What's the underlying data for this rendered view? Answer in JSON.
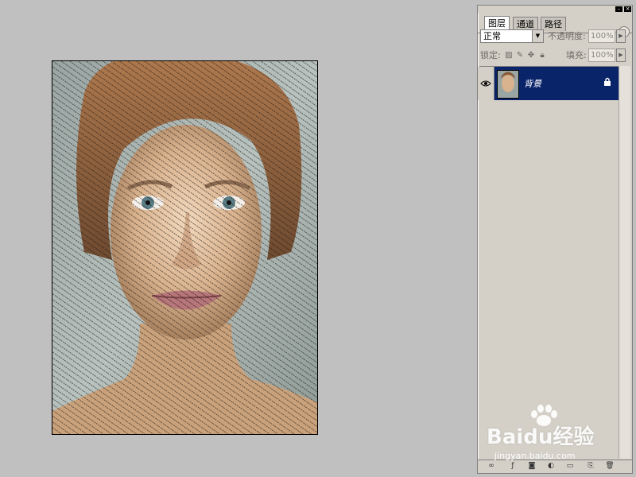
{
  "palette": {
    "tabs": [
      "图层",
      "通道",
      "路径"
    ],
    "active_tab": 0,
    "blend_mode": "正常",
    "opacity_label": "不透明度:",
    "opacity_value": "100%",
    "lock_label": "锁定:",
    "fill_label": "填充:",
    "fill_value": "100%",
    "layers": [
      {
        "name": "背景",
        "visible": true,
        "locked": true,
        "selected": true
      }
    ]
  },
  "watermark": {
    "brand": "Baidu经验",
    "url": "jingyan.baidu.com"
  },
  "colors": {
    "workspace": "#c0c0c0",
    "panel": "#d4d0c8",
    "selection": "#0a246a"
  },
  "icons": {
    "eye": "eye-icon",
    "lock": "lock-icon",
    "link": "link-layers-icon",
    "fx": "layer-style-icon",
    "mask": "layer-mask-icon",
    "adjust": "adjustment-layer-icon",
    "folder": "new-group-icon",
    "new": "new-layer-icon",
    "trash": "delete-layer-icon"
  }
}
